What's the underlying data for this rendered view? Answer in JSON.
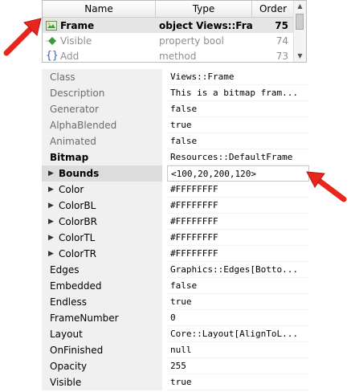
{
  "members": {
    "columns": {
      "name": "Name",
      "type": "Type",
      "order": "Order"
    },
    "rows": [
      {
        "name": "Frame",
        "type": "object Views::Frame",
        "order": "75",
        "icon": "frame-object-icon",
        "selected": true
      },
      {
        "name": "Visible",
        "type": "property bool",
        "order": "74",
        "icon": "property-icon",
        "selected": false
      },
      {
        "name": "Add",
        "type": "method",
        "order": "73",
        "icon": "method-braces-icon",
        "selected": false
      }
    ]
  },
  "inspector": {
    "rows": [
      {
        "name": "Class",
        "value": "Views::Frame"
      },
      {
        "name": "Description",
        "value": "This is a bitmap fram..."
      },
      {
        "name": "Generator",
        "value": "false"
      },
      {
        "name": "AlphaBlended",
        "value": "true"
      },
      {
        "name": "Animated",
        "value": "false"
      },
      {
        "name": "Bitmap",
        "value": "Resources::DefaultFrame"
      },
      {
        "name": "Bounds",
        "value": "<100,20,200,120>"
      },
      {
        "name": "Color",
        "value": "#FFFFFFFF"
      },
      {
        "name": "ColorBL",
        "value": "#FFFFFFFF"
      },
      {
        "name": "ColorBR",
        "value": "#FFFFFFFF"
      },
      {
        "name": "ColorTL",
        "value": "#FFFFFFFF"
      },
      {
        "name": "ColorTR",
        "value": "#FFFFFFFF"
      },
      {
        "name": "Edges",
        "value": "Graphics::Edges[Botto..."
      },
      {
        "name": "Embedded",
        "value": "false"
      },
      {
        "name": "Endless",
        "value": "true"
      },
      {
        "name": "FrameNumber",
        "value": "0"
      },
      {
        "name": "Layout",
        "value": "Core::Layout[AlignToL..."
      },
      {
        "name": "OnFinished",
        "value": "null"
      },
      {
        "name": "Opacity",
        "value": "255"
      },
      {
        "name": "Visible",
        "value": "true"
      }
    ]
  },
  "colors": {
    "annotation_arrow": "#e8261d",
    "selected_row": "#e5e5e5",
    "name_cell": "#f0f0f0"
  }
}
